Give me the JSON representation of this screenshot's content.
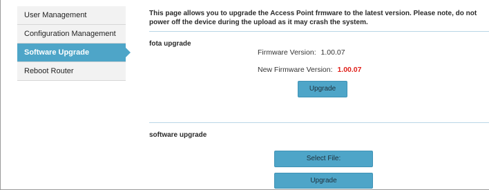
{
  "sidebar": {
    "items": [
      {
        "label": "User Management"
      },
      {
        "label": "Configuration Management"
      },
      {
        "label": "Software Upgrade"
      },
      {
        "label": "Reboot Router"
      }
    ]
  },
  "main": {
    "intro": "This page allows you to upgrade the Access Point frmware to the latest version. Please note, do not power off the device during the upload as it may crash the system.",
    "fota": {
      "title": "fota upgrade",
      "firmware_label": "Firmware Version:",
      "firmware_value": "1.00.07",
      "new_firmware_label": "New Firmware Version:",
      "new_firmware_value": "1.00.07",
      "upgrade_label": "Upgrade"
    },
    "software": {
      "title": "software upgrade",
      "select_label": "Select File:",
      "upgrade_label": "Upgrade"
    }
  },
  "colors": {
    "accent": "#4ea5c8",
    "new_version": "#e0201a",
    "sidebar_bg": "#f2f2f2"
  }
}
